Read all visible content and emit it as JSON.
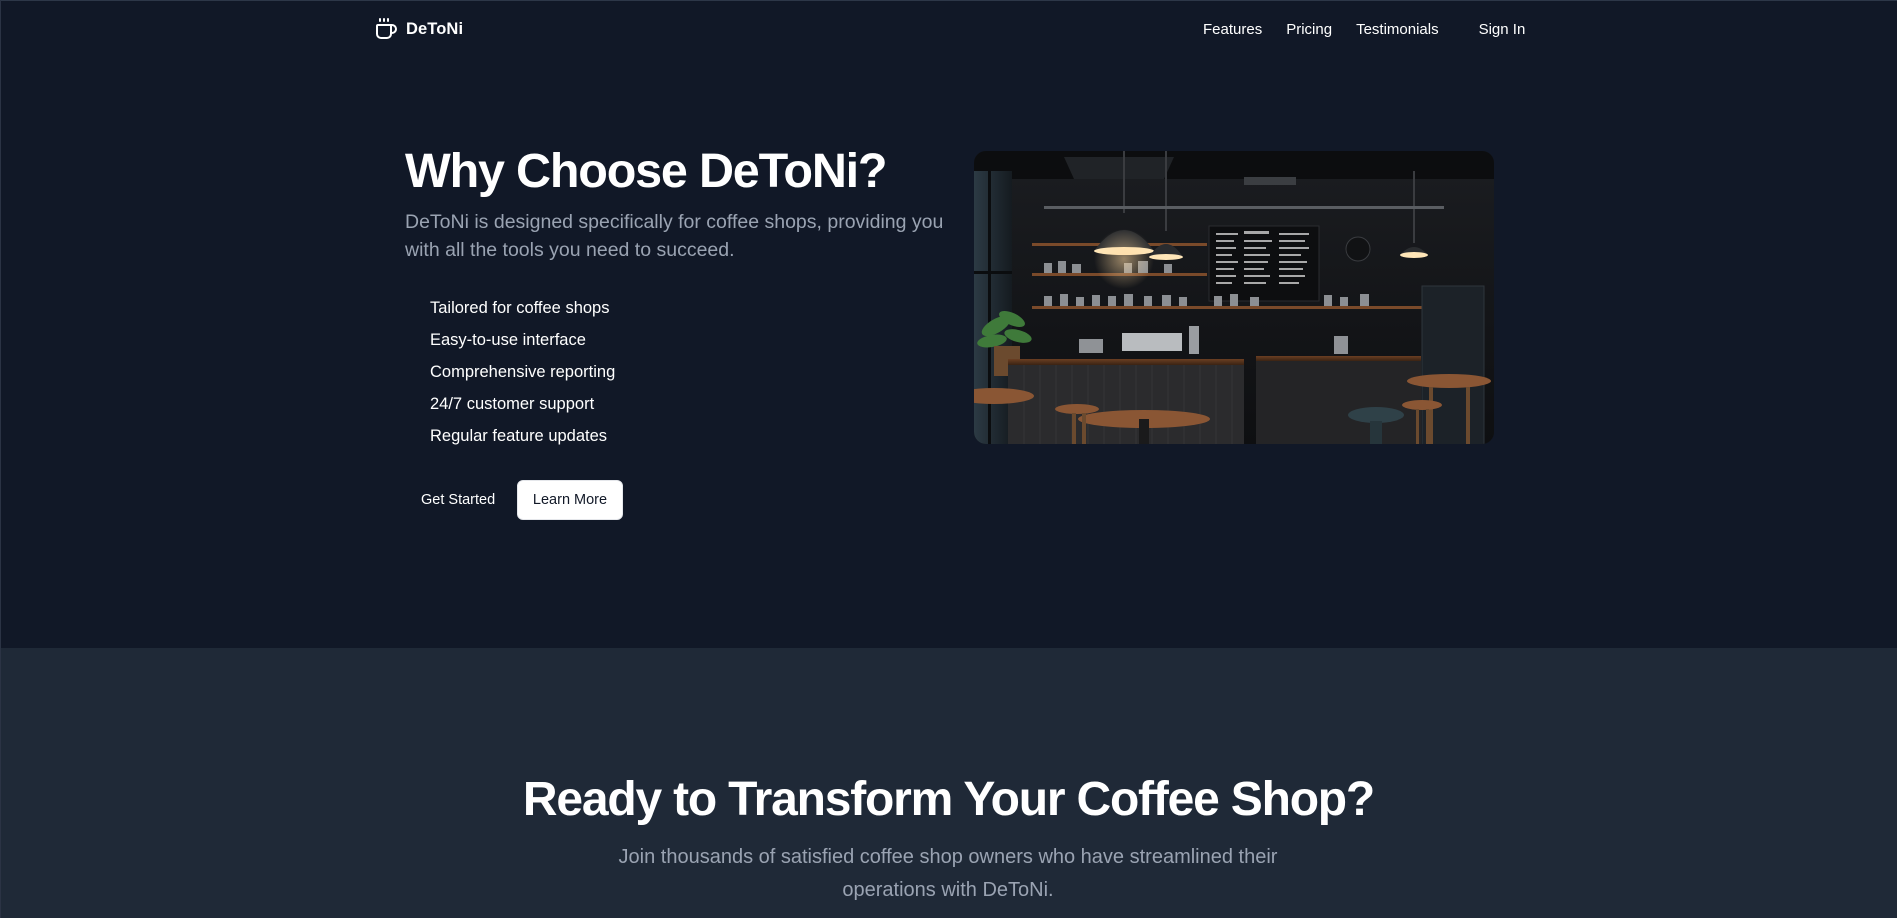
{
  "header": {
    "brand": "DeToNi",
    "nav": {
      "features": "Features",
      "pricing": "Pricing",
      "testimonials": "Testimonials",
      "sign_in": "Sign In"
    }
  },
  "hero": {
    "title": "Why Choose DeToNi?",
    "subtitle": "DeToNi is designed specifically for coffee shops, providing you with all the tools you need to succeed.",
    "features": [
      "Tailored for coffee shops",
      "Easy-to-use interface",
      "Comprehensive reporting",
      "24/7 customer support",
      "Regular feature updates"
    ],
    "buttons": {
      "get_started": "Get Started",
      "learn_more": "Learn More"
    },
    "image_icon": "coffee-shop-photo"
  },
  "cta": {
    "title": "Ready to Transform Your Coffee Shop?",
    "subtitle": "Join thousands of satisfied coffee shop owners who have streamlined their operations with DeToNi."
  },
  "colors": {
    "page_bg": "#111827",
    "cta_bg": "#1f2937",
    "muted_text": "#9aa3b2",
    "text": "#ffffff"
  }
}
